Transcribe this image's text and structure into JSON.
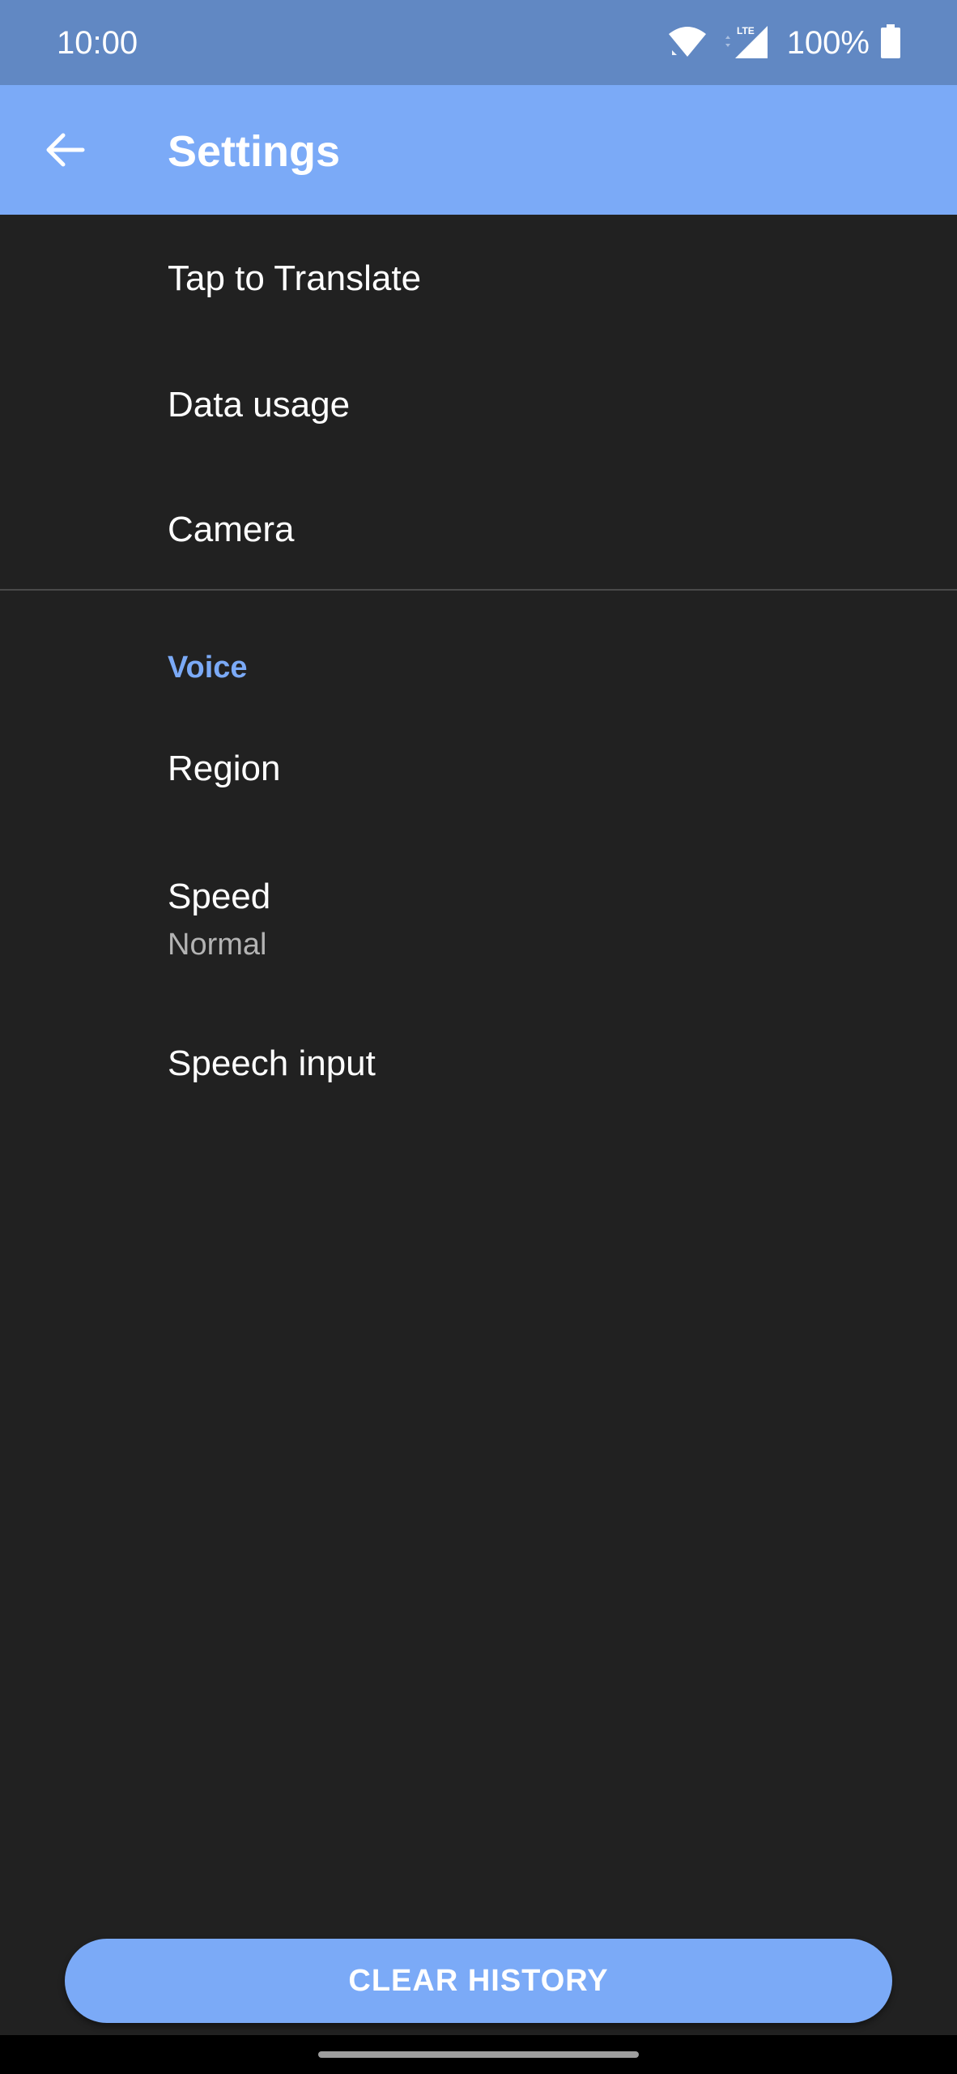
{
  "status_bar": {
    "time": "10:00",
    "network_label": "LTE",
    "battery": "100%",
    "icons": [
      "wifi-icon",
      "lte-signal-icon",
      "battery-icon"
    ]
  },
  "app_bar": {
    "title": "Settings",
    "back_icon": "arrow-back-icon"
  },
  "settings": {
    "general_items": [
      {
        "title": "Tap to Translate"
      },
      {
        "title": "Data usage"
      },
      {
        "title": "Camera"
      }
    ],
    "voice_section": {
      "header": "Voice",
      "items": [
        {
          "title": "Region"
        },
        {
          "title": "Speed",
          "subtitle": "Normal"
        },
        {
          "title": "Speech input"
        }
      ]
    }
  },
  "actions": {
    "clear_history_label": "CLEAR HISTORY"
  },
  "colors": {
    "status_bar": "#6188C3",
    "app_bar": "#7BAAF7",
    "background": "#212121",
    "accent": "#7BAAF7",
    "subtitle": "#B3B3B3"
  }
}
